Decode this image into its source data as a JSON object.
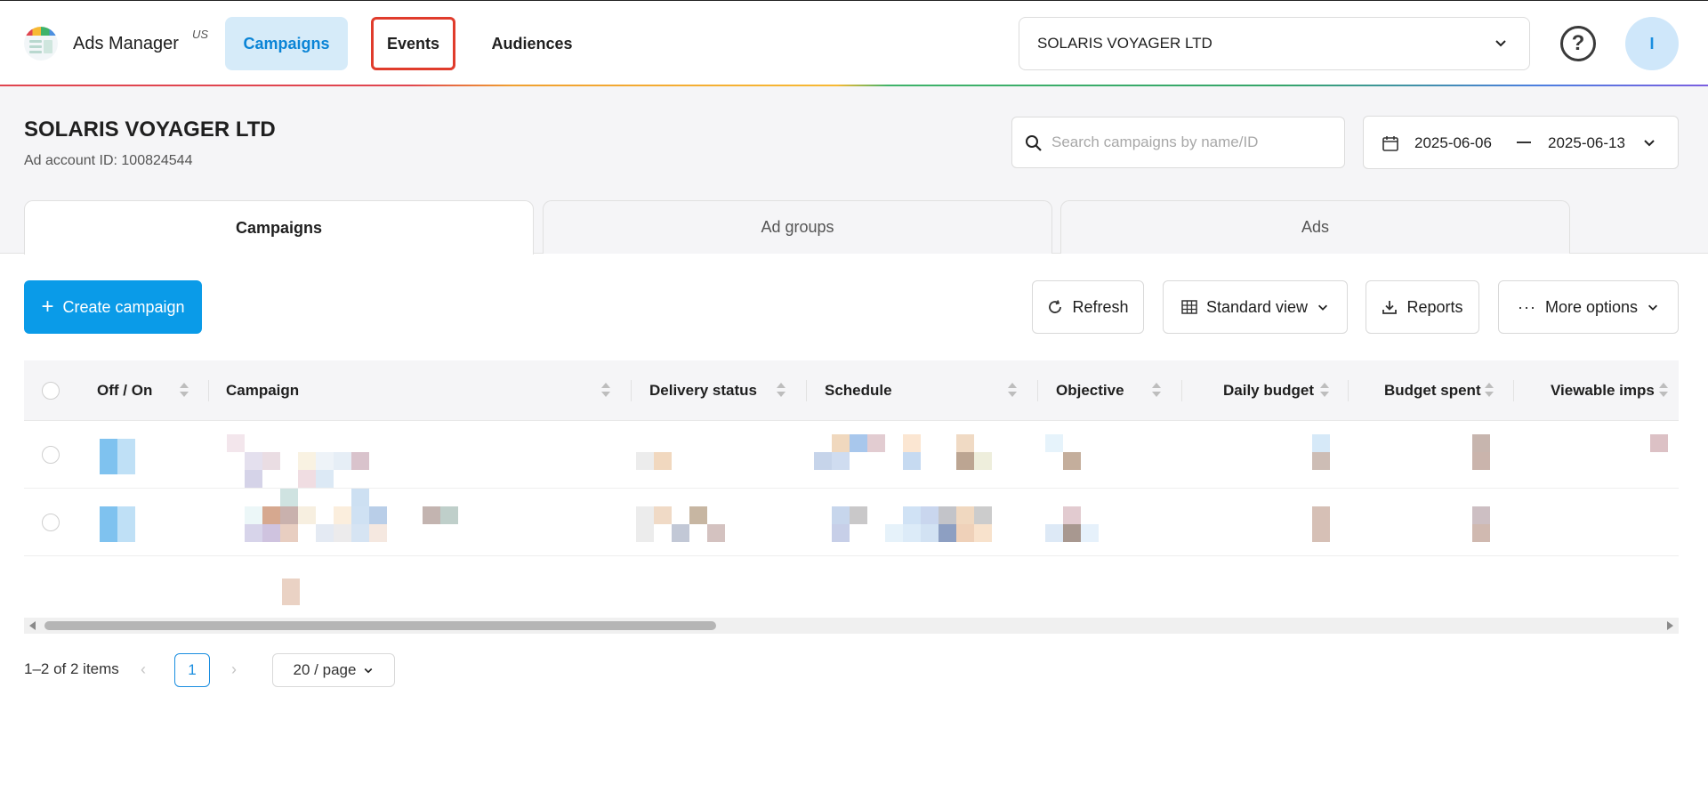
{
  "app": {
    "title": "Ads Manager",
    "region": "US"
  },
  "nav": {
    "tabs": [
      {
        "label": "Campaigns",
        "active": true
      },
      {
        "label": "Events",
        "highlighted": true
      },
      {
        "label": "Audiences"
      }
    ]
  },
  "account_selector": {
    "value": "SOLARIS VOYAGER LTD"
  },
  "user": {
    "avatar_initial": "I"
  },
  "account": {
    "name": "SOLARIS VOYAGER LTD",
    "id_text": "Ad account ID: 100824544"
  },
  "search": {
    "placeholder": "Search campaigns by name/ID"
  },
  "date_range": {
    "start": "2025-06-06",
    "end": "2025-06-13"
  },
  "sub_tabs": [
    {
      "label": "Campaigns",
      "active": true
    },
    {
      "label": "Ad groups"
    },
    {
      "label": "Ads"
    }
  ],
  "toolbar": {
    "create_label": "Create campaign",
    "refresh_label": "Refresh",
    "view_label": "Standard view",
    "reports_label": "Reports",
    "more_label": "More options"
  },
  "table": {
    "columns": [
      "Off / On",
      "Campaign",
      "Delivery status",
      "Schedule",
      "Objective",
      "Daily budget",
      "Budget spent",
      "Viewable imps"
    ],
    "rows_note_obscured": true
  },
  "pagination": {
    "summary": "1–2 of 2 items",
    "current_page": "1",
    "page_size": "20 / page"
  },
  "colors": {
    "accent": "#0a9be8",
    "active_tab_bg": "#d6ebf9",
    "highlight_border": "#e03c2c"
  }
}
